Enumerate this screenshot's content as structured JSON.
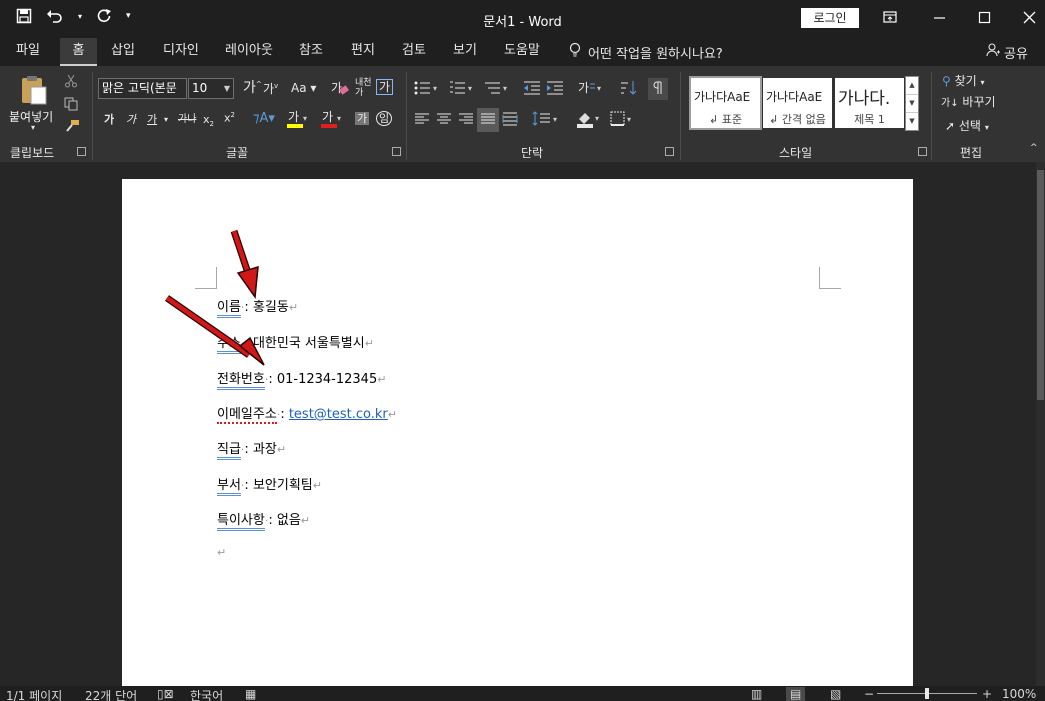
{
  "window": {
    "title": "문서1 - Word",
    "login_label": "로그인"
  },
  "menu": {
    "tabs": [
      "파일",
      "홈",
      "삽입",
      "디자인",
      "레이아웃",
      "참조",
      "편지",
      "검토",
      "보기",
      "도움말"
    ],
    "active_tab": "홈",
    "tell_me": "어떤 작업을 원하시나요?",
    "share": "공유"
  },
  "ribbon": {
    "clipboard": {
      "paste_label": "붙여넣기",
      "group": "클립보드"
    },
    "font": {
      "group": "글꼴",
      "font_name": "맑은 고딕(본문",
      "font_size": "10"
    },
    "paragraph": {
      "group": "단락"
    },
    "styles": {
      "group": "스타일",
      "items": [
        {
          "sample": "가나다AaE",
          "name": "↲ 표준"
        },
        {
          "sample": "가나다AaE",
          "name": "↲ 간격 없음"
        },
        {
          "sample": "가나다.",
          "name": "제목 1"
        }
      ]
    },
    "editing": {
      "group": "편집",
      "find": "찾기",
      "replace": "바꾸기",
      "select": "선택"
    }
  },
  "document": {
    "lines": [
      {
        "label": "이름",
        "value": "홍길동"
      },
      {
        "label": "주소",
        "value": "대한민국 서울특별시"
      },
      {
        "label": "전화번호",
        "value": "01-1234-12345"
      },
      {
        "label": "이메일주소",
        "value": "test@test.co.kr"
      },
      {
        "label": "직급",
        "value": "과장"
      },
      {
        "label": "부서",
        "value": "보안기획팀"
      },
      {
        "label": "특이사항",
        "value": "없음"
      }
    ],
    "colon": ": ",
    "para_mark": "↵"
  },
  "status": {
    "page": "1/1 페이지",
    "words": "22개 단어",
    "language": "한국어",
    "zoom": "100%"
  },
  "colors": {
    "accent_arrow": "#d01818",
    "ribbon_bg": "#333333",
    "title_bg": "#1f1f1f"
  }
}
